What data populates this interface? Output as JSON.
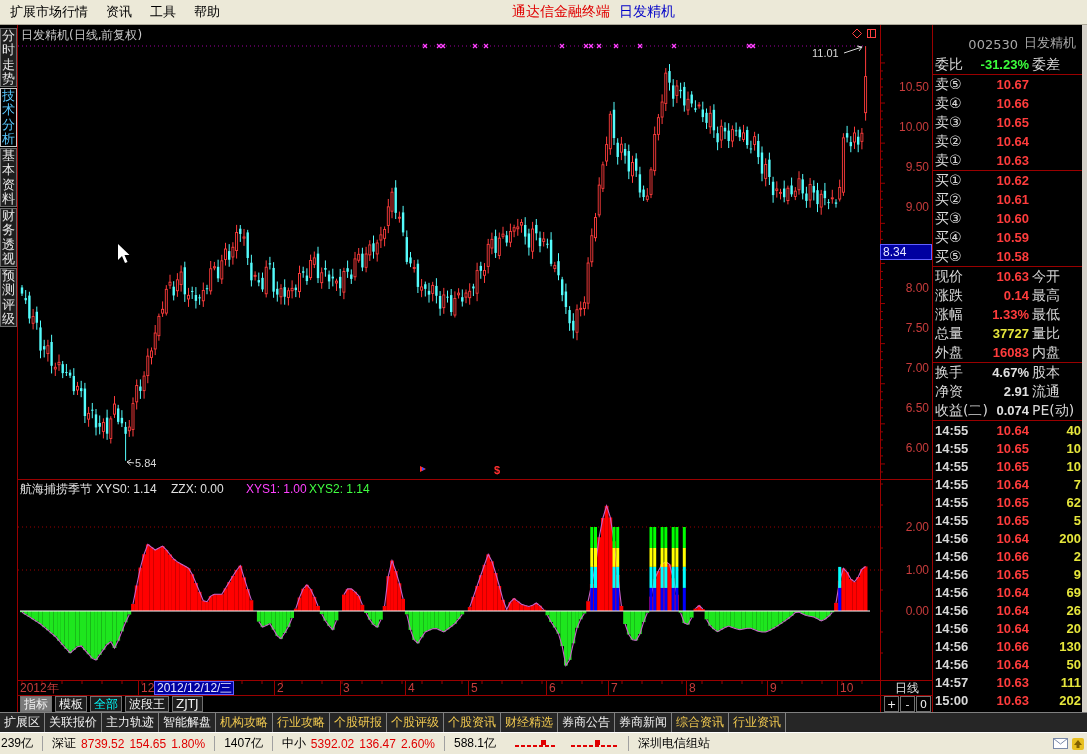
{
  "menu_bar": {
    "items": [
      "扩展市场行情",
      "资讯",
      "工具",
      "帮助"
    ],
    "app_title": "通达信金融终端",
    "stock_title": "日发精机"
  },
  "side_tabs": [
    {
      "label": "分时走势",
      "selected": false
    },
    {
      "label": "技术分析",
      "selected": true
    },
    {
      "label": "基本资料",
      "selected": false
    },
    {
      "label": "财务透视",
      "selected": false
    },
    {
      "label": "预测评级",
      "selected": false
    }
  ],
  "price_chart": {
    "title": "日发精机(日线,前复权)",
    "high_label": "11.01",
    "low_label": "5.84",
    "marker_symbol": "$",
    "axis_labels": [
      "10.50",
      "10.00",
      "9.50",
      "9.00",
      "8.00",
      "7.50",
      "7.00",
      "6.50",
      "6.00"
    ],
    "cursor_price": "8.34"
  },
  "indicator": {
    "name": "航海捕捞季节",
    "legend": [
      {
        "label": "XYS0: 1.14",
        "color": "#e0e0e0"
      },
      {
        "label": "ZZX: 0.00",
        "color": "#e0e0e0"
      },
      {
        "label": "XYS1: 1.00",
        "color": "#ff40ff"
      },
      {
        "label": "XYS2: 1.14",
        "color": "#40ff40"
      }
    ],
    "axis_labels": [
      "2.00",
      "1.00",
      "0.00"
    ]
  },
  "date_axis": {
    "labels": [
      "2012年",
      "12",
      "2",
      "3",
      "4",
      "5",
      "6",
      "7",
      "8",
      "9",
      "10"
    ],
    "cursor_date": "2012/12/12/三",
    "period": "日线"
  },
  "indicator_tabs": [
    {
      "label": "指标",
      "selected": true,
      "highlighted": false
    },
    {
      "label": "模板",
      "selected": false,
      "highlighted": false
    },
    {
      "label": "全部",
      "selected": false,
      "highlighted": true
    },
    {
      "label": "波段王",
      "selected": false,
      "highlighted": false
    },
    {
      "label": "ZJTJ",
      "selected": false,
      "highlighted": false
    }
  ],
  "zoom_buttons": [
    "+",
    "-",
    "0"
  ],
  "quote_panel": {
    "stock_code": "002530",
    "stock_name": "日发精机",
    "ratio": {
      "label": "委比",
      "value": "-31.23%",
      "color": "#3cff3c",
      "label2": "委差"
    },
    "asks": [
      {
        "label": "卖⑤",
        "price": "10.67",
        "color": "#ff3c3c"
      },
      {
        "label": "卖④",
        "price": "10.66",
        "color": "#ff3c3c"
      },
      {
        "label": "卖③",
        "price": "10.65",
        "color": "#ff3c3c"
      },
      {
        "label": "卖②",
        "price": "10.64",
        "color": "#ff3c3c"
      },
      {
        "label": "卖①",
        "price": "10.63",
        "color": "#ff3c3c"
      }
    ],
    "bids": [
      {
        "label": "买①",
        "price": "10.62",
        "color": "#ff3c3c"
      },
      {
        "label": "买②",
        "price": "10.61",
        "color": "#ff3c3c"
      },
      {
        "label": "买③",
        "price": "10.60",
        "color": "#ff3c3c"
      },
      {
        "label": "买④",
        "price": "10.59",
        "color": "#ff3c3c"
      },
      {
        "label": "买⑤",
        "price": "10.58",
        "color": "#ff3c3c"
      }
    ],
    "stats": [
      {
        "label": "现价",
        "value": "10.63",
        "color": "#ff3c3c",
        "label2": "今开"
      },
      {
        "label": "涨跌",
        "value": "0.14",
        "color": "#ff3c3c",
        "label2": "最高"
      },
      {
        "label": "涨幅",
        "value": "1.33%",
        "color": "#ff3c3c",
        "label2": "最低"
      },
      {
        "label": "总量",
        "value": "37727",
        "color": "#e6e63c",
        "label2": "量比"
      },
      {
        "label": "外盘",
        "value": "16083",
        "color": "#ff3c3c",
        "label2": "内盘"
      }
    ],
    "fundamentals": [
      {
        "label": "换手",
        "value": "4.67%",
        "color": "#e0e0e0",
        "label2": "股本"
      },
      {
        "label": "净资",
        "value": "2.91",
        "color": "#e0e0e0",
        "label2": "流通"
      },
      {
        "label": "收益(二)",
        "value": "0.074",
        "color": "#e0e0e0",
        "label2": "PE(动)"
      }
    ],
    "ticks": [
      {
        "time": "14:55",
        "price": "10.64",
        "volume": "40",
        "color": "#ff3c3c"
      },
      {
        "time": "14:55",
        "price": "10.65",
        "volume": "10",
        "color": "#ff3c3c"
      },
      {
        "time": "14:55",
        "price": "10.65",
        "volume": "10",
        "color": "#ff3c3c"
      },
      {
        "time": "14:55",
        "price": "10.64",
        "volume": "7",
        "color": "#ff3c3c"
      },
      {
        "time": "14:55",
        "price": "10.65",
        "volume": "62",
        "color": "#ff3c3c"
      },
      {
        "time": "14:55",
        "price": "10.65",
        "volume": "5",
        "color": "#ff3c3c"
      },
      {
        "time": "14:56",
        "price": "10.64",
        "volume": "200",
        "color": "#ff3c3c"
      },
      {
        "time": "14:56",
        "price": "10.66",
        "volume": "2",
        "color": "#ff3c3c"
      },
      {
        "time": "14:56",
        "price": "10.65",
        "volume": "9",
        "color": "#ff3c3c"
      },
      {
        "time": "14:56",
        "price": "10.64",
        "volume": "69",
        "color": "#ff3c3c"
      },
      {
        "time": "14:56",
        "price": "10.64",
        "volume": "26",
        "color": "#ff3c3c"
      },
      {
        "time": "14:56",
        "price": "10.64",
        "volume": "20",
        "color": "#ff3c3c"
      },
      {
        "time": "14:56",
        "price": "10.66",
        "volume": "130",
        "color": "#ff3c3c"
      },
      {
        "time": "14:56",
        "price": "10.64",
        "volume": "50",
        "color": "#ff3c3c"
      },
      {
        "time": "14:57",
        "price": "10.63",
        "volume": "111",
        "color": "#ff3c3c"
      },
      {
        "time": "15:00",
        "price": "10.63",
        "volume": "202",
        "color": "#ff3c3c"
      }
    ]
  },
  "bottom_tabs": [
    {
      "label": "扩展区",
      "highlighted": false
    },
    {
      "label": "关联报价",
      "highlighted": false
    },
    {
      "label": "主力轨迹",
      "highlighted": false
    },
    {
      "label": "智能解盘",
      "highlighted": false
    },
    {
      "label": "机构攻略",
      "highlighted": true
    },
    {
      "label": "行业攻略",
      "highlighted": true
    },
    {
      "label": "个股研报",
      "highlighted": true
    },
    {
      "label": "个股评级",
      "highlighted": true
    },
    {
      "label": "个股资讯",
      "highlighted": true
    },
    {
      "label": "财经精选",
      "highlighted": true
    },
    {
      "label": "券商公告",
      "highlighted": false
    },
    {
      "label": "券商新闻",
      "highlighted": false
    },
    {
      "label": "综合资讯",
      "highlighted": true
    },
    {
      "label": "行业资讯",
      "highlighted": true
    }
  ],
  "status_bar": {
    "leading_amount": "239亿",
    "indices": [
      {
        "name": "深证",
        "value": "8739.52",
        "change": "154.65",
        "percent": "1.80%",
        "color": "#e00000",
        "amount": "1407亿"
      },
      {
        "name": "中小",
        "value": "5392.02",
        "change": "136.47",
        "percent": "2.60%",
        "color": "#e00000",
        "amount": "588.1亿"
      }
    ],
    "server": "深圳电信组站"
  }
}
